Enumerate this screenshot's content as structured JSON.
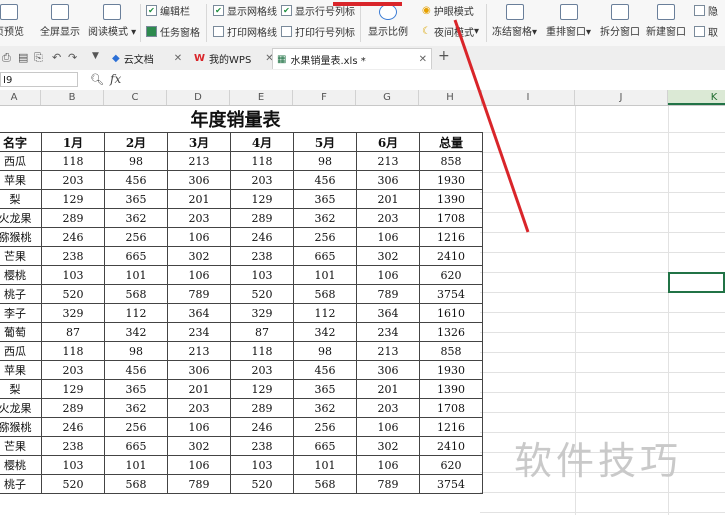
{
  "ribbon": {
    "page_preview": "页预览",
    "fullscreen": "全屏显示",
    "reading_mode": "阅读模式",
    "edit_bar": "编辑栏",
    "task_pane": "任务窗格",
    "show_gridlines": "显示网格线",
    "print_gridlines": "打印网格线",
    "show_row_col_headers": "显示行号列标",
    "print_row_col_headers": "打印行号列标",
    "display_scale": "显示比例",
    "eye_protection": "护眼模式",
    "night_mode": "夜间模式",
    "freeze_panes": "冻结窗格",
    "rearrange_windows": "重排窗口",
    "split_window": "拆分窗口",
    "new_window": "新建窗口",
    "hide": "隐",
    "cancel": "取"
  },
  "tabs": [
    {
      "label": "云文档"
    },
    {
      "label": "我的WPS"
    },
    {
      "label": "水果销量表.xls *"
    }
  ],
  "formula_bar": {
    "cell_ref": "I9",
    "fx": "fx"
  },
  "columns": [
    "A",
    "B",
    "C",
    "D",
    "E",
    "F",
    "G",
    "H",
    "I",
    "J",
    "K"
  ],
  "sheet": {
    "title": "年度销量表",
    "headers": [
      "名字",
      "1月",
      "2月",
      "3月",
      "4月",
      "5月",
      "6月",
      "总量"
    ],
    "rows": [
      [
        "西瓜",
        "118",
        "98",
        "213",
        "118",
        "98",
        "213",
        "858"
      ],
      [
        "苹果",
        "203",
        "456",
        "306",
        "203",
        "456",
        "306",
        "1930"
      ],
      [
        "梨",
        "129",
        "365",
        "201",
        "129",
        "365",
        "201",
        "1390"
      ],
      [
        "火龙果",
        "289",
        "362",
        "203",
        "289",
        "362",
        "203",
        "1708"
      ],
      [
        "猕猴桃",
        "246",
        "256",
        "106",
        "246",
        "256",
        "106",
        "1216"
      ],
      [
        "芒果",
        "238",
        "665",
        "302",
        "238",
        "665",
        "302",
        "2410"
      ],
      [
        "樱桃",
        "103",
        "101",
        "106",
        "103",
        "101",
        "106",
        "620"
      ],
      [
        "桃子",
        "520",
        "568",
        "789",
        "520",
        "568",
        "789",
        "3754"
      ],
      [
        "李子",
        "329",
        "112",
        "364",
        "329",
        "112",
        "364",
        "1610"
      ],
      [
        "葡萄",
        "87",
        "342",
        "234",
        "87",
        "342",
        "234",
        "1326"
      ],
      [
        "西瓜",
        "118",
        "98",
        "213",
        "118",
        "98",
        "213",
        "858"
      ],
      [
        "苹果",
        "203",
        "456",
        "306",
        "203",
        "456",
        "306",
        "1930"
      ],
      [
        "梨",
        "129",
        "365",
        "201",
        "129",
        "365",
        "201",
        "1390"
      ],
      [
        "火龙果",
        "289",
        "362",
        "203",
        "289",
        "362",
        "203",
        "1708"
      ],
      [
        "猕猴桃",
        "246",
        "256",
        "106",
        "246",
        "256",
        "106",
        "1216"
      ],
      [
        "芒果",
        "238",
        "665",
        "302",
        "238",
        "665",
        "302",
        "2410"
      ],
      [
        "樱桃",
        "103",
        "101",
        "106",
        "103",
        "101",
        "106",
        "620"
      ],
      [
        "桃子",
        "520",
        "568",
        "789",
        "520",
        "568",
        "789",
        "3754"
      ]
    ]
  },
  "watermark": "软件技巧",
  "colors": {
    "accent": "#217346",
    "arrow": "#d9252a"
  }
}
